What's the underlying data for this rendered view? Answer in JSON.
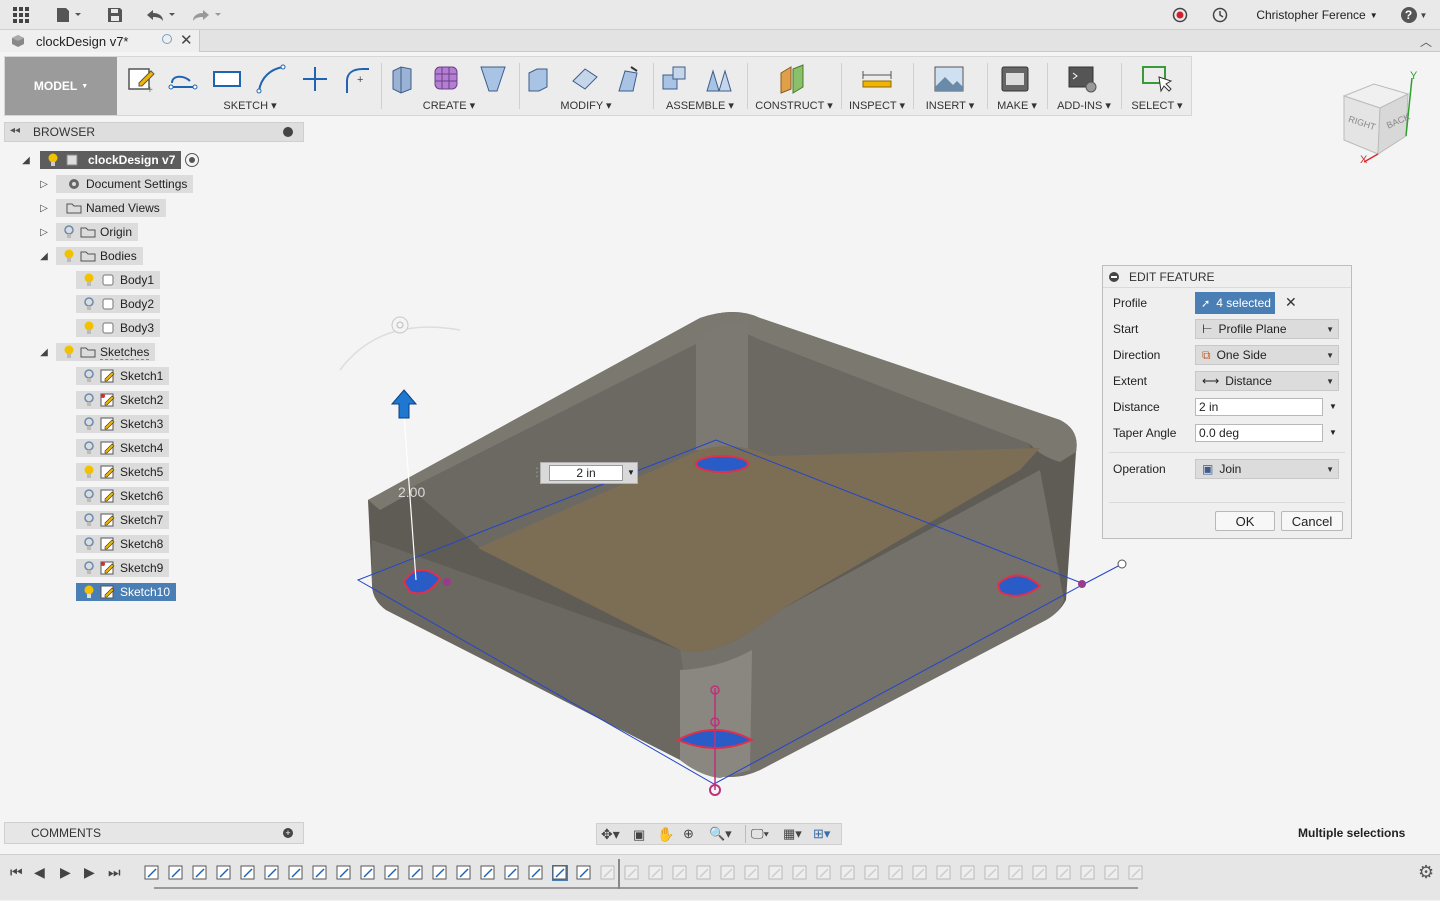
{
  "app": {
    "user_name": "Christopher Ference",
    "help_label": "?"
  },
  "tab": {
    "title": "clockDesign v7*"
  },
  "toolbar": {
    "workspace": "MODEL",
    "groups": [
      {
        "label": "SKETCH"
      },
      {
        "label": "CREATE"
      },
      {
        "label": "MODIFY"
      },
      {
        "label": "ASSEMBLE"
      },
      {
        "label": "CONSTRUCT"
      },
      {
        "label": "INSPECT"
      },
      {
        "label": "INSERT"
      },
      {
        "label": "MAKE"
      },
      {
        "label": "ADD-INS"
      },
      {
        "label": "SELECT"
      }
    ]
  },
  "viewcube": {
    "face_right": "RIGHT",
    "face_back": "BACK",
    "axis_y": "Y",
    "axis_x": "X"
  },
  "browser": {
    "title": "BROWSER",
    "root": "clockDesign v7",
    "items": [
      {
        "label": "Document Settings"
      },
      {
        "label": "Named Views"
      },
      {
        "label": "Origin"
      },
      {
        "label": "Bodies"
      },
      {
        "label": "Body1"
      },
      {
        "label": "Body2"
      },
      {
        "label": "Body3"
      },
      {
        "label": "Sketches"
      },
      {
        "label": "Sketch1"
      },
      {
        "label": "Sketch2"
      },
      {
        "label": "Sketch3"
      },
      {
        "label": "Sketch4"
      },
      {
        "label": "Sketch5"
      },
      {
        "label": "Sketch6"
      },
      {
        "label": "Sketch7"
      },
      {
        "label": "Sketch8"
      },
      {
        "label": "Sketch9"
      },
      {
        "label": "Sketch10"
      }
    ]
  },
  "edit_feature": {
    "title": "EDIT FEATURE",
    "rows": {
      "profile_label": "Profile",
      "profile_value": "4 selected",
      "start_label": "Start",
      "start_value": "Profile Plane",
      "direction_label": "Direction",
      "direction_value": "One Side",
      "extent_label": "Extent",
      "extent_value": "Distance",
      "distance_label": "Distance",
      "distance_value": "2 in",
      "taper_label": "Taper Angle",
      "taper_value": "0.0 deg",
      "operation_label": "Operation",
      "operation_value": "Join"
    },
    "ok_label": "OK",
    "cancel_label": "Cancel"
  },
  "viewport": {
    "dim_value": "2 in",
    "dim_readout": "2.00"
  },
  "comments": {
    "title": "COMMENTS"
  },
  "status": {
    "text": "Multiple selections"
  },
  "colors": {
    "selection": "#4a7fb5",
    "accent_blue": "#1e78d2",
    "body": "#6d6a63",
    "floor": "#7c6d55",
    "profile_outline": "#e0304a"
  }
}
